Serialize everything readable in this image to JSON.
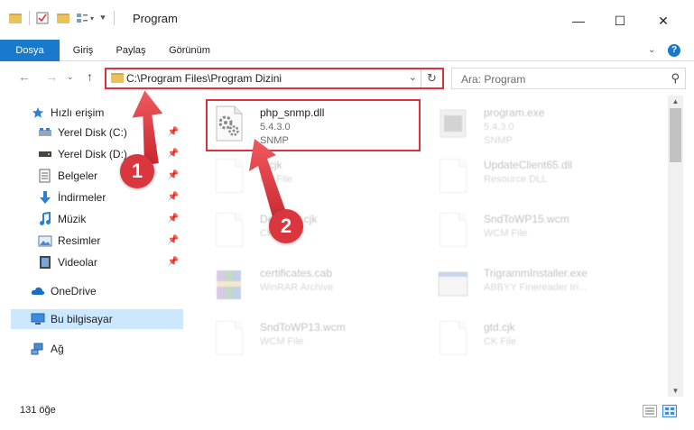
{
  "window": {
    "title": "Program",
    "minimize": "—",
    "maximize": "☐",
    "close": "✕"
  },
  "ribbon": {
    "tabs": [
      "Dosya",
      "Giriş",
      "Paylaş",
      "Görünüm"
    ],
    "help": "?"
  },
  "nav": {
    "back": "←",
    "forward": "→",
    "up": "↑",
    "address": "C:\\Program Files\\Program Dizini",
    "search_placeholder": "Ara: Program"
  },
  "sidebar": {
    "items": [
      {
        "label": "Hızlı erişim",
        "icon": "star-icon"
      },
      {
        "label": "Yerel Disk (C:)",
        "icon": "drive-icon"
      },
      {
        "label": "Yerel Disk (D:)",
        "icon": "drive-icon"
      },
      {
        "label": "Belgeler",
        "icon": "documents-icon"
      },
      {
        "label": "İndirmeler",
        "icon": "download-icon"
      },
      {
        "label": "Müzik",
        "icon": "music-icon"
      },
      {
        "label": "Resimler",
        "icon": "pictures-icon"
      },
      {
        "label": "Videolar",
        "icon": "video-icon"
      },
      {
        "label": "OneDrive",
        "icon": "cloud-icon"
      },
      {
        "label": "Bu bilgisayar",
        "icon": "computer-icon"
      },
      {
        "label": "Ağ",
        "icon": "network-icon"
      }
    ]
  },
  "files": [
    {
      "name": "php_snmp.dll",
      "line2": "5.4.3.0",
      "line3": "SNMP"
    },
    {
      "name": "program.exe",
      "line2": "5.4.3.0",
      "line3": "SNMP"
    },
    {
      "name": "...cjk",
      "line2": "CK File",
      "line3": ""
    },
    {
      "name": "UpdateClient65.dll",
      "line2": "Resource DLL",
      "line3": ""
    },
    {
      "name": "Det...ent.cjk",
      "line2": "CK File",
      "line3": ""
    },
    {
      "name": "SndToWP15.wcm",
      "line2": "WCM File",
      "line3": ""
    },
    {
      "name": "certificates.cab",
      "line2": "WinRAR Archive",
      "line3": ""
    },
    {
      "name": "TrigrammInstaller.exe",
      "line2": "ABBYY Finereader tri...",
      "line3": ""
    },
    {
      "name": "SndToWP13.wcm",
      "line2": "WCM File",
      "line3": ""
    },
    {
      "name": "gtd.cjk",
      "line2": "CK File",
      "line3": ""
    }
  ],
  "status": {
    "count": "131 öğe"
  },
  "annotations": {
    "badge1": "1",
    "badge2": "2"
  },
  "colors": {
    "accent": "#1979ca",
    "highlight": "#e0303b",
    "selected": "#cce8ff"
  }
}
